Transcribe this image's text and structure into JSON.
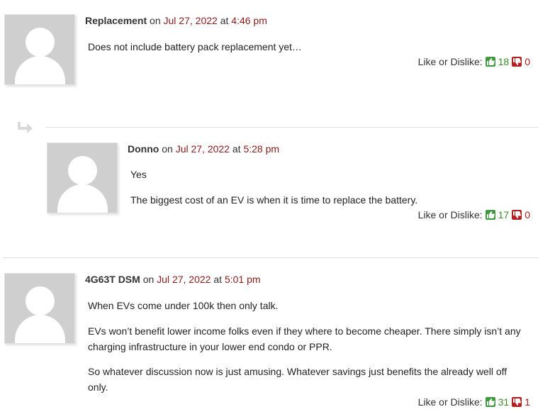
{
  "comments": [
    {
      "author": "Replacement",
      "on": "on",
      "date": "Jul 27, 2022",
      "at": "at",
      "time": "4:46 pm",
      "paragraphs": [
        "Does not include battery pack replacement yet…"
      ],
      "likes_label": "Like or Dislike:",
      "likes": "18",
      "dislikes": "0"
    },
    {
      "author": "Donno",
      "on": "on",
      "date": "Jul 27, 2022",
      "at": "at",
      "time": "5:28 pm",
      "paragraphs": [
        "Yes",
        "The biggest cost of an EV is when it is time to replace the battery."
      ],
      "likes_label": "Like or Dislike:",
      "likes": "17",
      "dislikes": "0"
    },
    {
      "author": "4G63T DSM",
      "on": "on",
      "date": "Jul 27, 2022",
      "at": "at",
      "time": "5:01 pm",
      "paragraphs": [
        "When EVs come under 100k then only talk.",
        "EVs won’t benefit lower income folks even if they where to become cheaper. There simply isn’t any",
        "charging infrastructure in your lower end condo or PPR.",
        "So whatever discussion now is just amusing. Whatever savings just benefits the already well off",
        "only."
      ],
      "likes_label": "Like or Dislike:",
      "likes": "31",
      "dislikes": "1"
    }
  ],
  "icons": {
    "reply": "reply-arrow-icon",
    "like": "thumbs-up-icon",
    "dislike": "thumbs-down-icon"
  },
  "colors": {
    "date": "#8b1a1a",
    "like": "#3a8a2a",
    "dislike": "#b02020"
  }
}
